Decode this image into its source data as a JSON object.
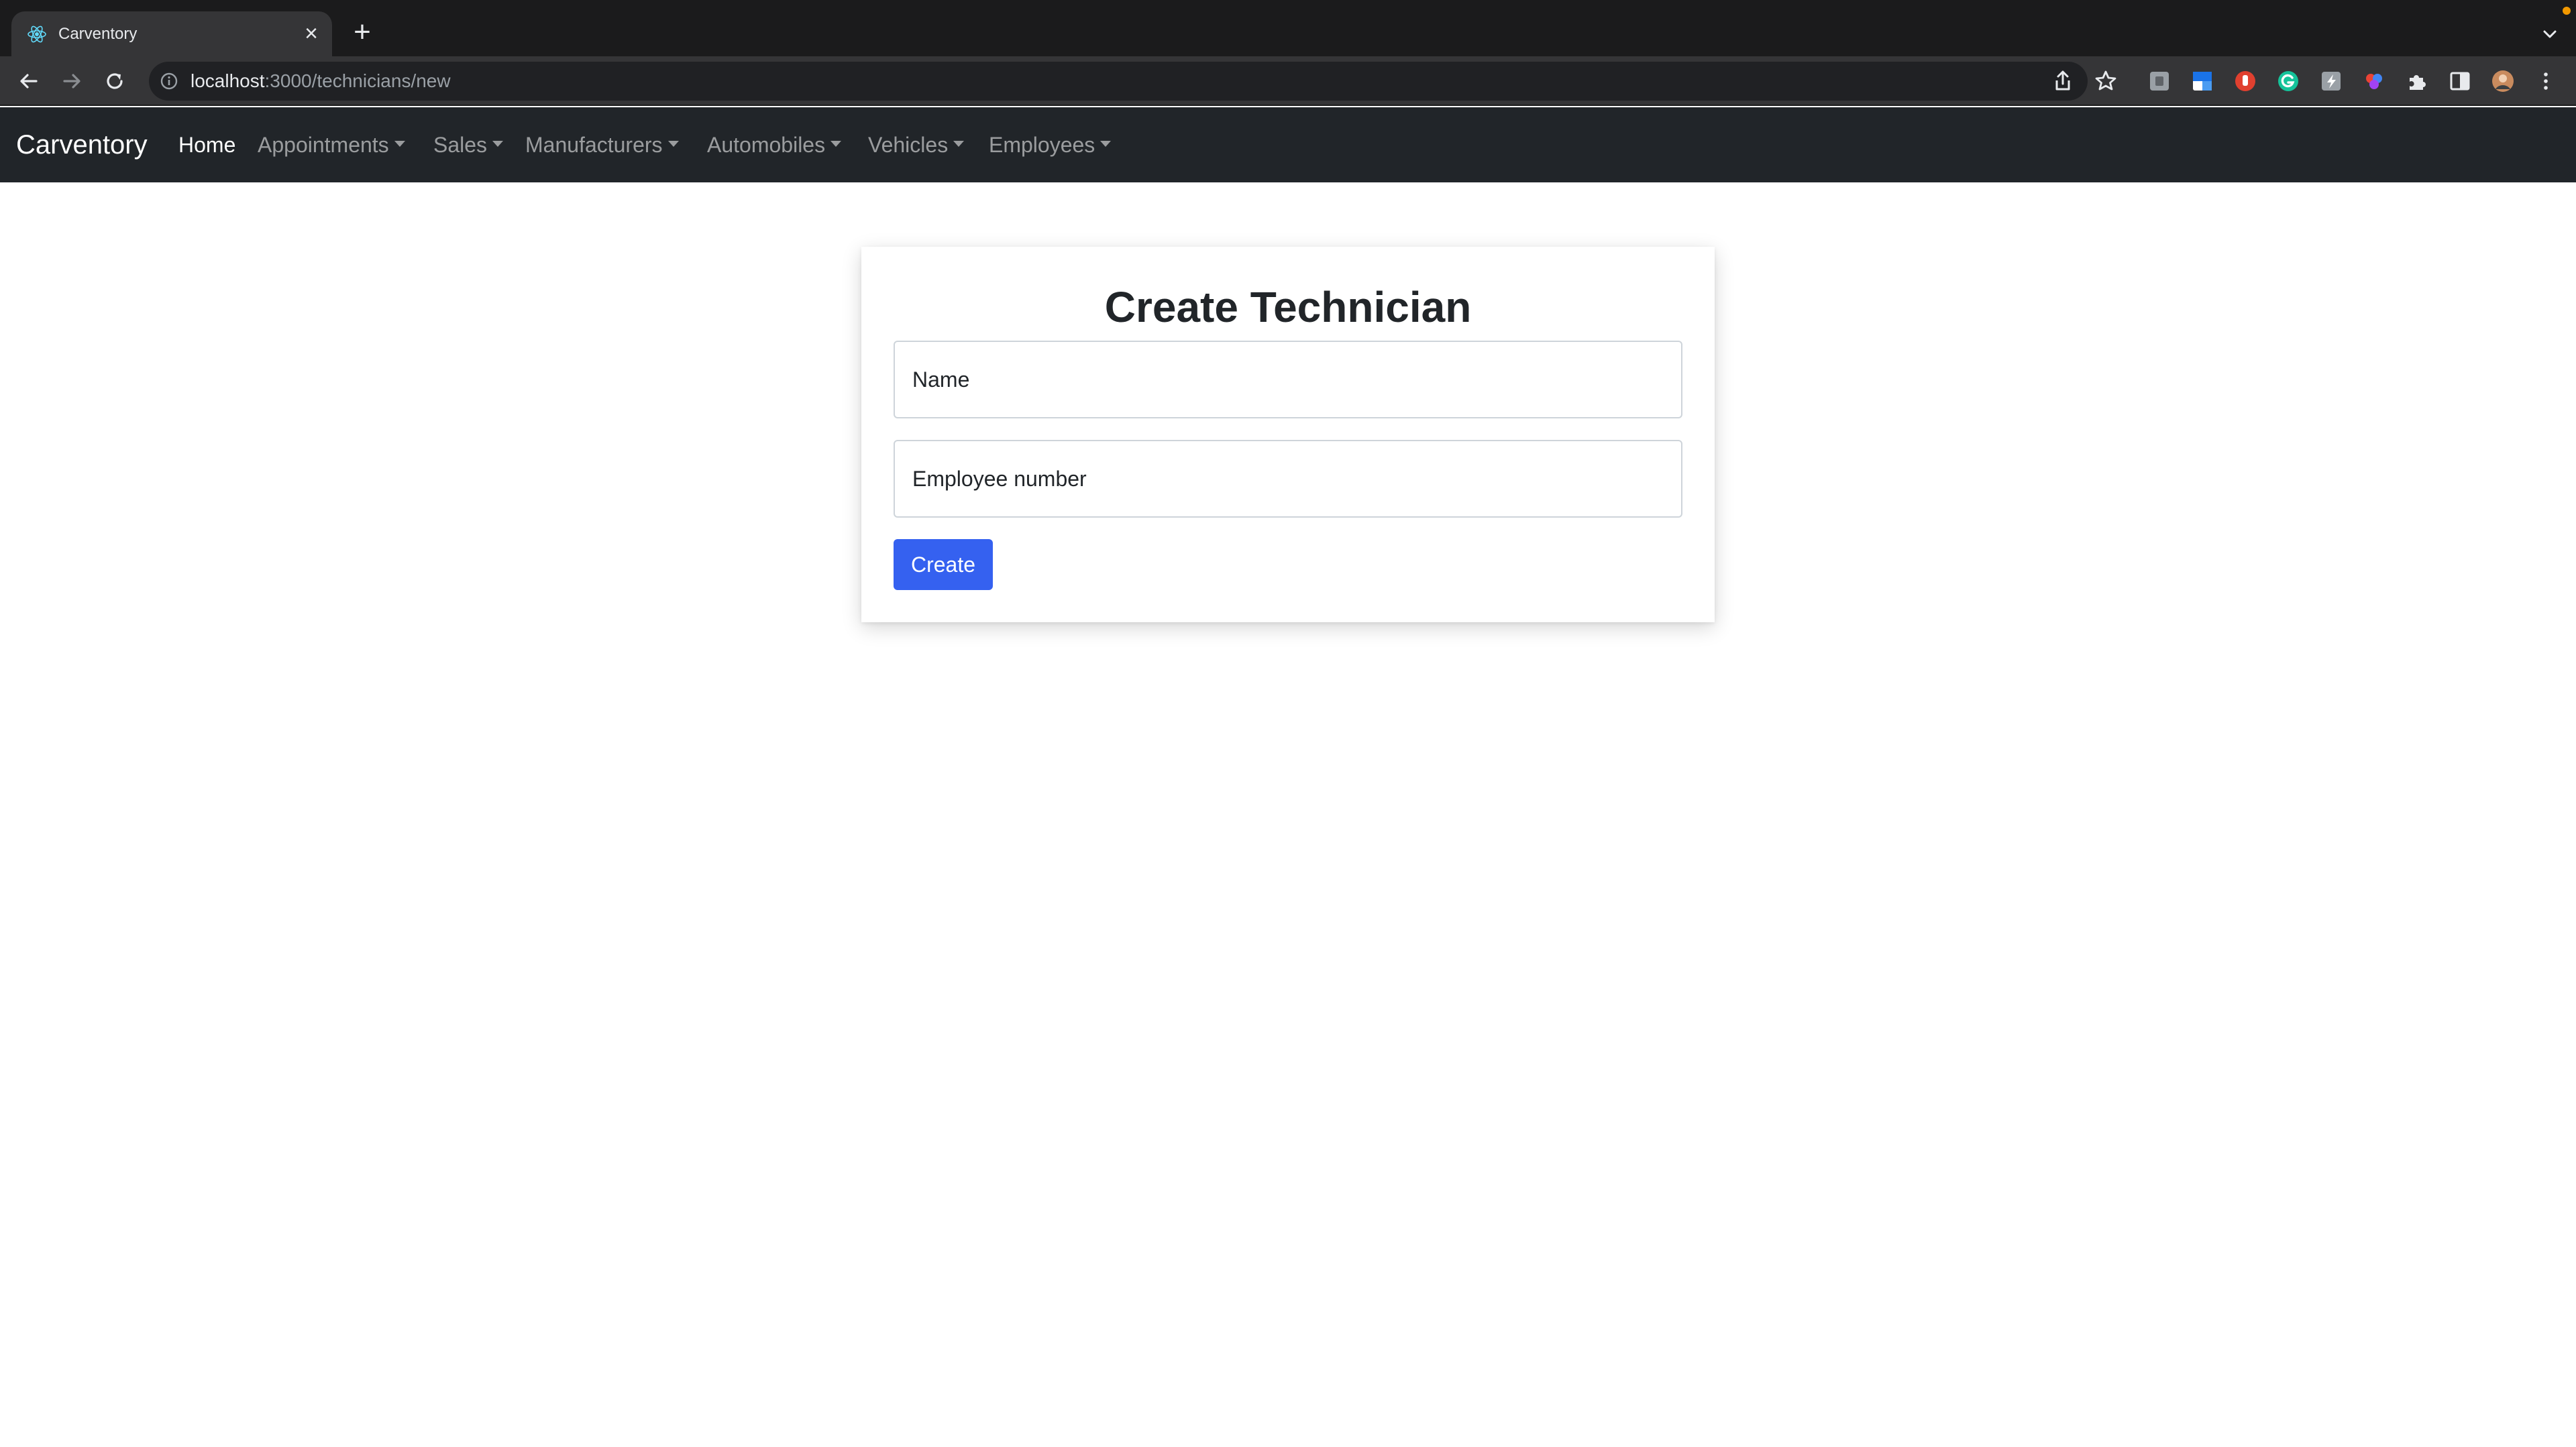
{
  "browser": {
    "tab_title": "Carventory",
    "url_host": "localhost",
    "url_rest": ":3000/technicians/new"
  },
  "navbar": {
    "brand": "Carventory",
    "home": "Home",
    "appointments": "Appointments",
    "sales": "Sales",
    "manufacturers": "Manufacturers",
    "automobiles": "Automobiles",
    "vehicles": "Vehicles",
    "employees": "Employees"
  },
  "form": {
    "title": "Create Technician",
    "name_placeholder": "Name",
    "employee_number_placeholder": "Employee number",
    "create_label": "Create"
  },
  "colors": {
    "navbar_bg": "#212529",
    "primary_button": "#3561f0",
    "browser_frame": "#1b1b1c"
  }
}
